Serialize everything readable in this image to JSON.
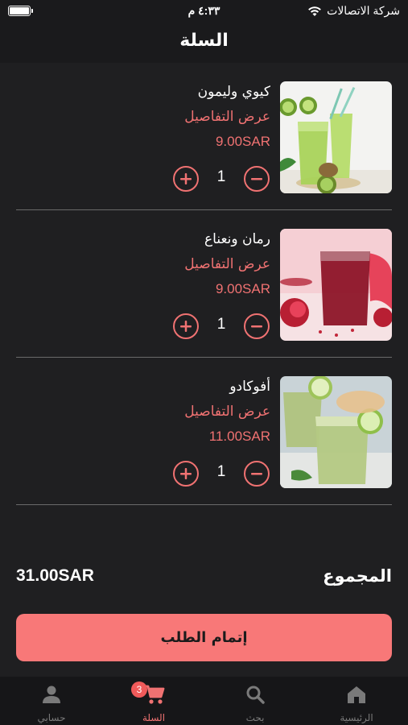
{
  "status_bar": {
    "carrier": "شركة الاتصالات",
    "time": "٤:٣٣ م"
  },
  "header": {
    "title": "السلة"
  },
  "cart": {
    "items": [
      {
        "name": "كيوي وليمون",
        "details_link": "عرض التفاصيل",
        "price": "9.00SAR",
        "quantity": "1",
        "image_icon": "kiwi-lemon-juice-image"
      },
      {
        "name": "رمان ونعناع",
        "details_link": "عرض التفاصيل",
        "price": "9.00SAR",
        "quantity": "1",
        "image_icon": "pomegranate-mint-juice-image"
      },
      {
        "name": "أفوكادو",
        "details_link": "عرض التفاصيل",
        "price": "11.00SAR",
        "quantity": "1",
        "image_icon": "avocado-juice-image"
      }
    ]
  },
  "summary": {
    "total_label": "المجموع",
    "total_value": "31.00SAR"
  },
  "checkout": {
    "label": "إتمام الطلب"
  },
  "tab_bar": {
    "items": [
      {
        "label": "الرئيسية",
        "icon": "home-icon"
      },
      {
        "label": "بحث",
        "icon": "search-icon"
      },
      {
        "label": "السلة",
        "icon": "cart-icon",
        "badge": "3",
        "active": true
      },
      {
        "label": "حسابي",
        "icon": "person-icon"
      }
    ]
  },
  "colors": {
    "accent": "#f07272",
    "button": "#f87878",
    "background": "#1f1f21"
  }
}
